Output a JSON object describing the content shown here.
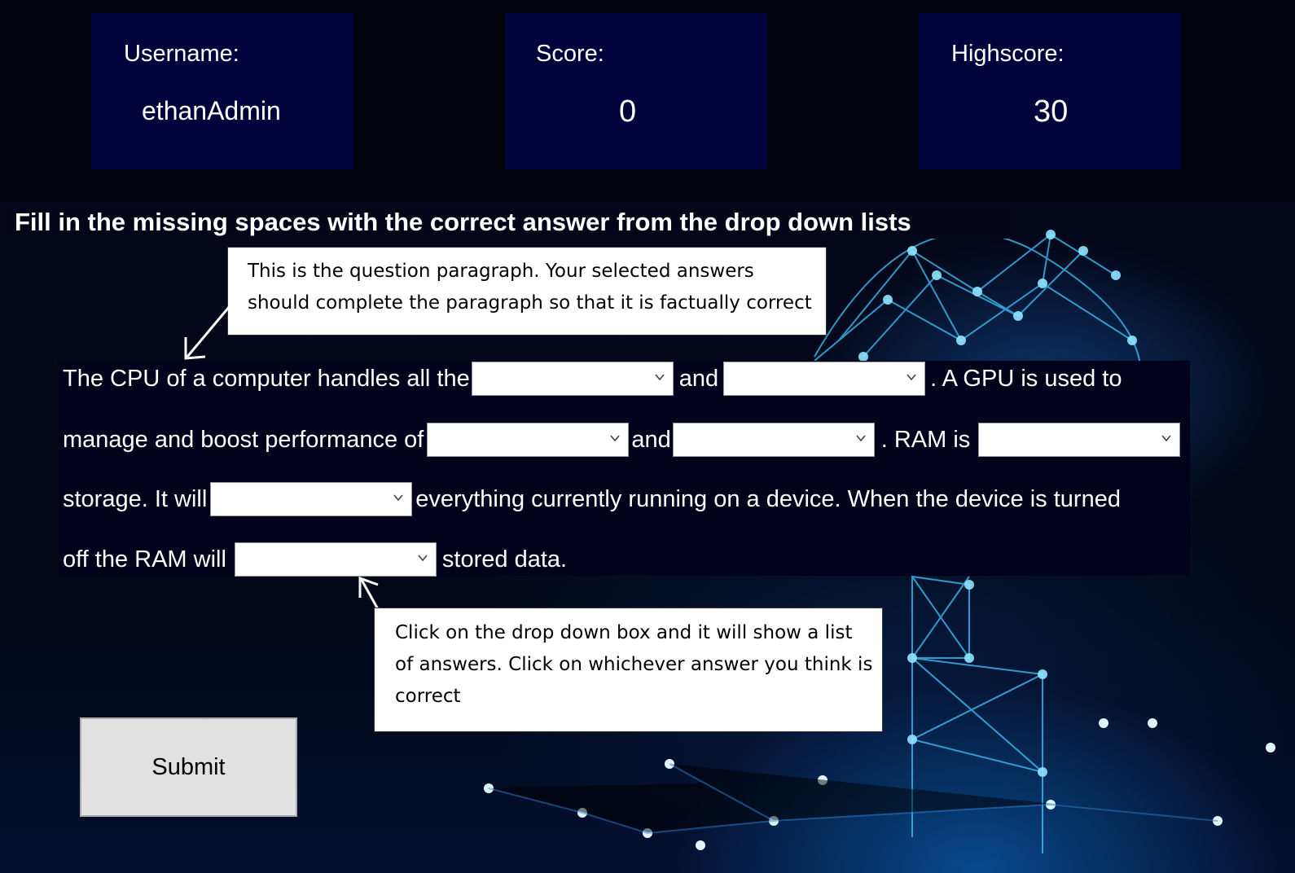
{
  "stats": {
    "username_label": "Username:",
    "username_value": "ethanAdmin",
    "score_label": "Score:",
    "score_value": "0",
    "highscore_label": "Highscore:",
    "highscore_value": "30"
  },
  "instruction": "Fill in the missing spaces with the correct answer from the drop down lists",
  "callouts": {
    "paragraph_line1": "This is the question paragraph. Your selected answers",
    "paragraph_line2": "should complete the paragraph so that it is factually correct",
    "dropdown_line1": "Click on the drop down box and it will show a list",
    "dropdown_line2": "of answers. Click on whichever answer you think is",
    "dropdown_line3": "correct"
  },
  "paragraph": {
    "t1": "The CPU of a computer handles all the",
    "t2": "and",
    "t3": ".  A GPU is used to",
    "t4": "manage and boost performance of",
    "t5": "and",
    "t6": ". RAM is",
    "t7": "storage. It will",
    "t8": "everything currently running on a device. When the device is turned",
    "t9": "off the RAM will",
    "t10": "stored data."
  },
  "dropdowns": {
    "d1": "",
    "d2": "",
    "d3": "",
    "d4": "",
    "d5": "",
    "d6": "",
    "d7": ""
  },
  "submit_label": "Submit",
  "colors": {
    "stat_box": "#02023c",
    "background": "#03030d",
    "accent_network": "#2aa8ff"
  }
}
